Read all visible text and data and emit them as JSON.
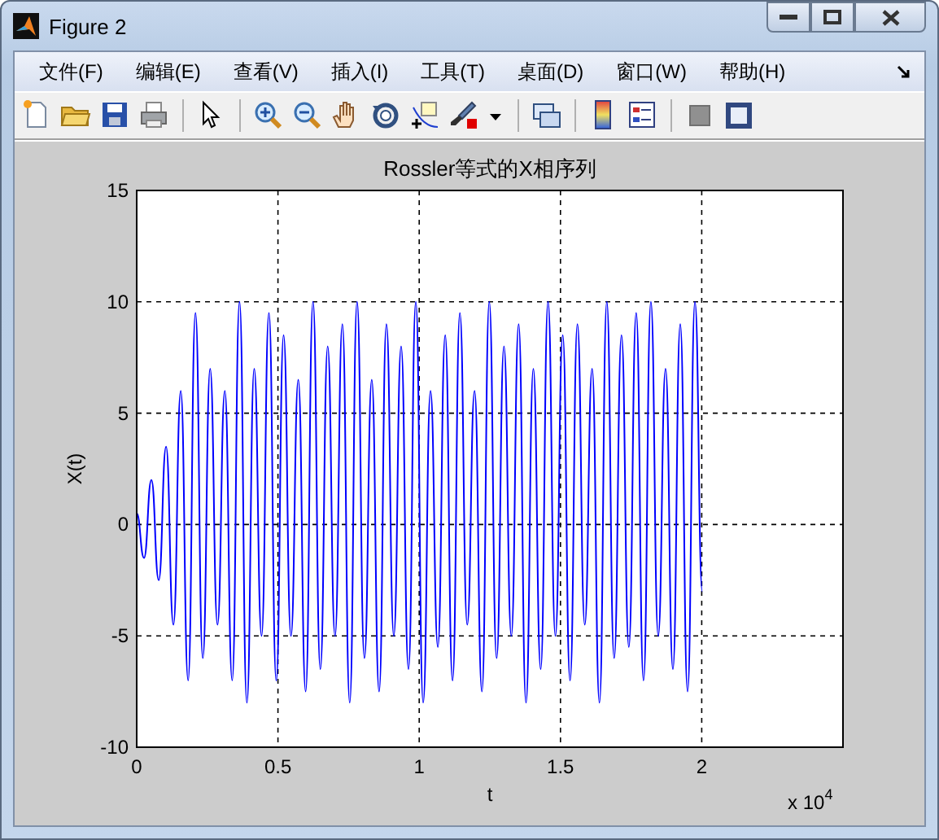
{
  "window": {
    "title": "Figure 2"
  },
  "menu": [
    {
      "label": "文件(F)"
    },
    {
      "label": "编辑(E)"
    },
    {
      "label": "查看(V)"
    },
    {
      "label": "插入(I)"
    },
    {
      "label": "工具(T)"
    },
    {
      "label": "桌面(D)"
    },
    {
      "label": "窗口(W)"
    },
    {
      "label": "帮助(H)"
    }
  ],
  "plot": {
    "chart_data": {
      "type": "line",
      "title": "Rossler等式的X相序列",
      "xlabel": "t",
      "ylabel": "X(t)",
      "xlim": [
        0,
        2.5
      ],
      "ylim": [
        -10,
        15
      ],
      "xticks": [
        0,
        0.5,
        1,
        1.5,
        2
      ],
      "yticks": [
        -10,
        -5,
        0,
        5,
        10,
        15
      ],
      "x": [
        0,
        0.026,
        0.052,
        0.078,
        0.104,
        0.13,
        0.156,
        0.182,
        0.208,
        0.234,
        0.26,
        0.286,
        0.312,
        0.338,
        0.364,
        0.39,
        0.416,
        0.442,
        0.468,
        0.494,
        0.52,
        0.546,
        0.572,
        0.598,
        0.624,
        0.65,
        0.676,
        0.702,
        0.728,
        0.754,
        0.78,
        0.806,
        0.832,
        0.858,
        0.884,
        0.91,
        0.936,
        0.962,
        0.988,
        1.014,
        1.04,
        1.066,
        1.092,
        1.118,
        1.144,
        1.17,
        1.196,
        1.222,
        1.248,
        1.274,
        1.3,
        1.326,
        1.352,
        1.378,
        1.404,
        1.43,
        1.456,
        1.482,
        1.508,
        1.534,
        1.56,
        1.586,
        1.612,
        1.638,
        1.664,
        1.69,
        1.716,
        1.742,
        1.768,
        1.794,
        1.82,
        1.846,
        1.872,
        1.898,
        1.924,
        1.95,
        1.976,
        2.002
      ],
      "grid": true,
      "series": [
        {
          "color": "#0000ff",
          "values": [
            0.5,
            -1.5,
            2,
            -2.5,
            3.5,
            -4.5,
            6,
            -7,
            9.5,
            -6,
            7,
            -4.5,
            6,
            -7,
            10,
            -8,
            7,
            -5,
            9.5,
            -7,
            8.5,
            -5,
            6.5,
            -7.5,
            10,
            -6.5,
            8,
            -5,
            9,
            -8,
            10,
            -6,
            6.5,
            -7.5,
            9,
            -5,
            8,
            -6.5,
            10,
            -8,
            6,
            -5.5,
            8.5,
            -7,
            9.5,
            -4.5,
            6,
            -7.5,
            10,
            -6,
            8,
            -5,
            9,
            -8,
            7,
            -6.5,
            10,
            -5,
            8.5,
            -7,
            9,
            -4.5,
            7,
            -8,
            10,
            -6,
            8.5,
            -5.5,
            9.5,
            -7,
            10,
            -5,
            7,
            -6.5,
            9,
            -7.5,
            10,
            -3
          ]
        }
      ]
    },
    "multiplier": {
      "base": "x 10",
      "exponent": "4"
    }
  }
}
